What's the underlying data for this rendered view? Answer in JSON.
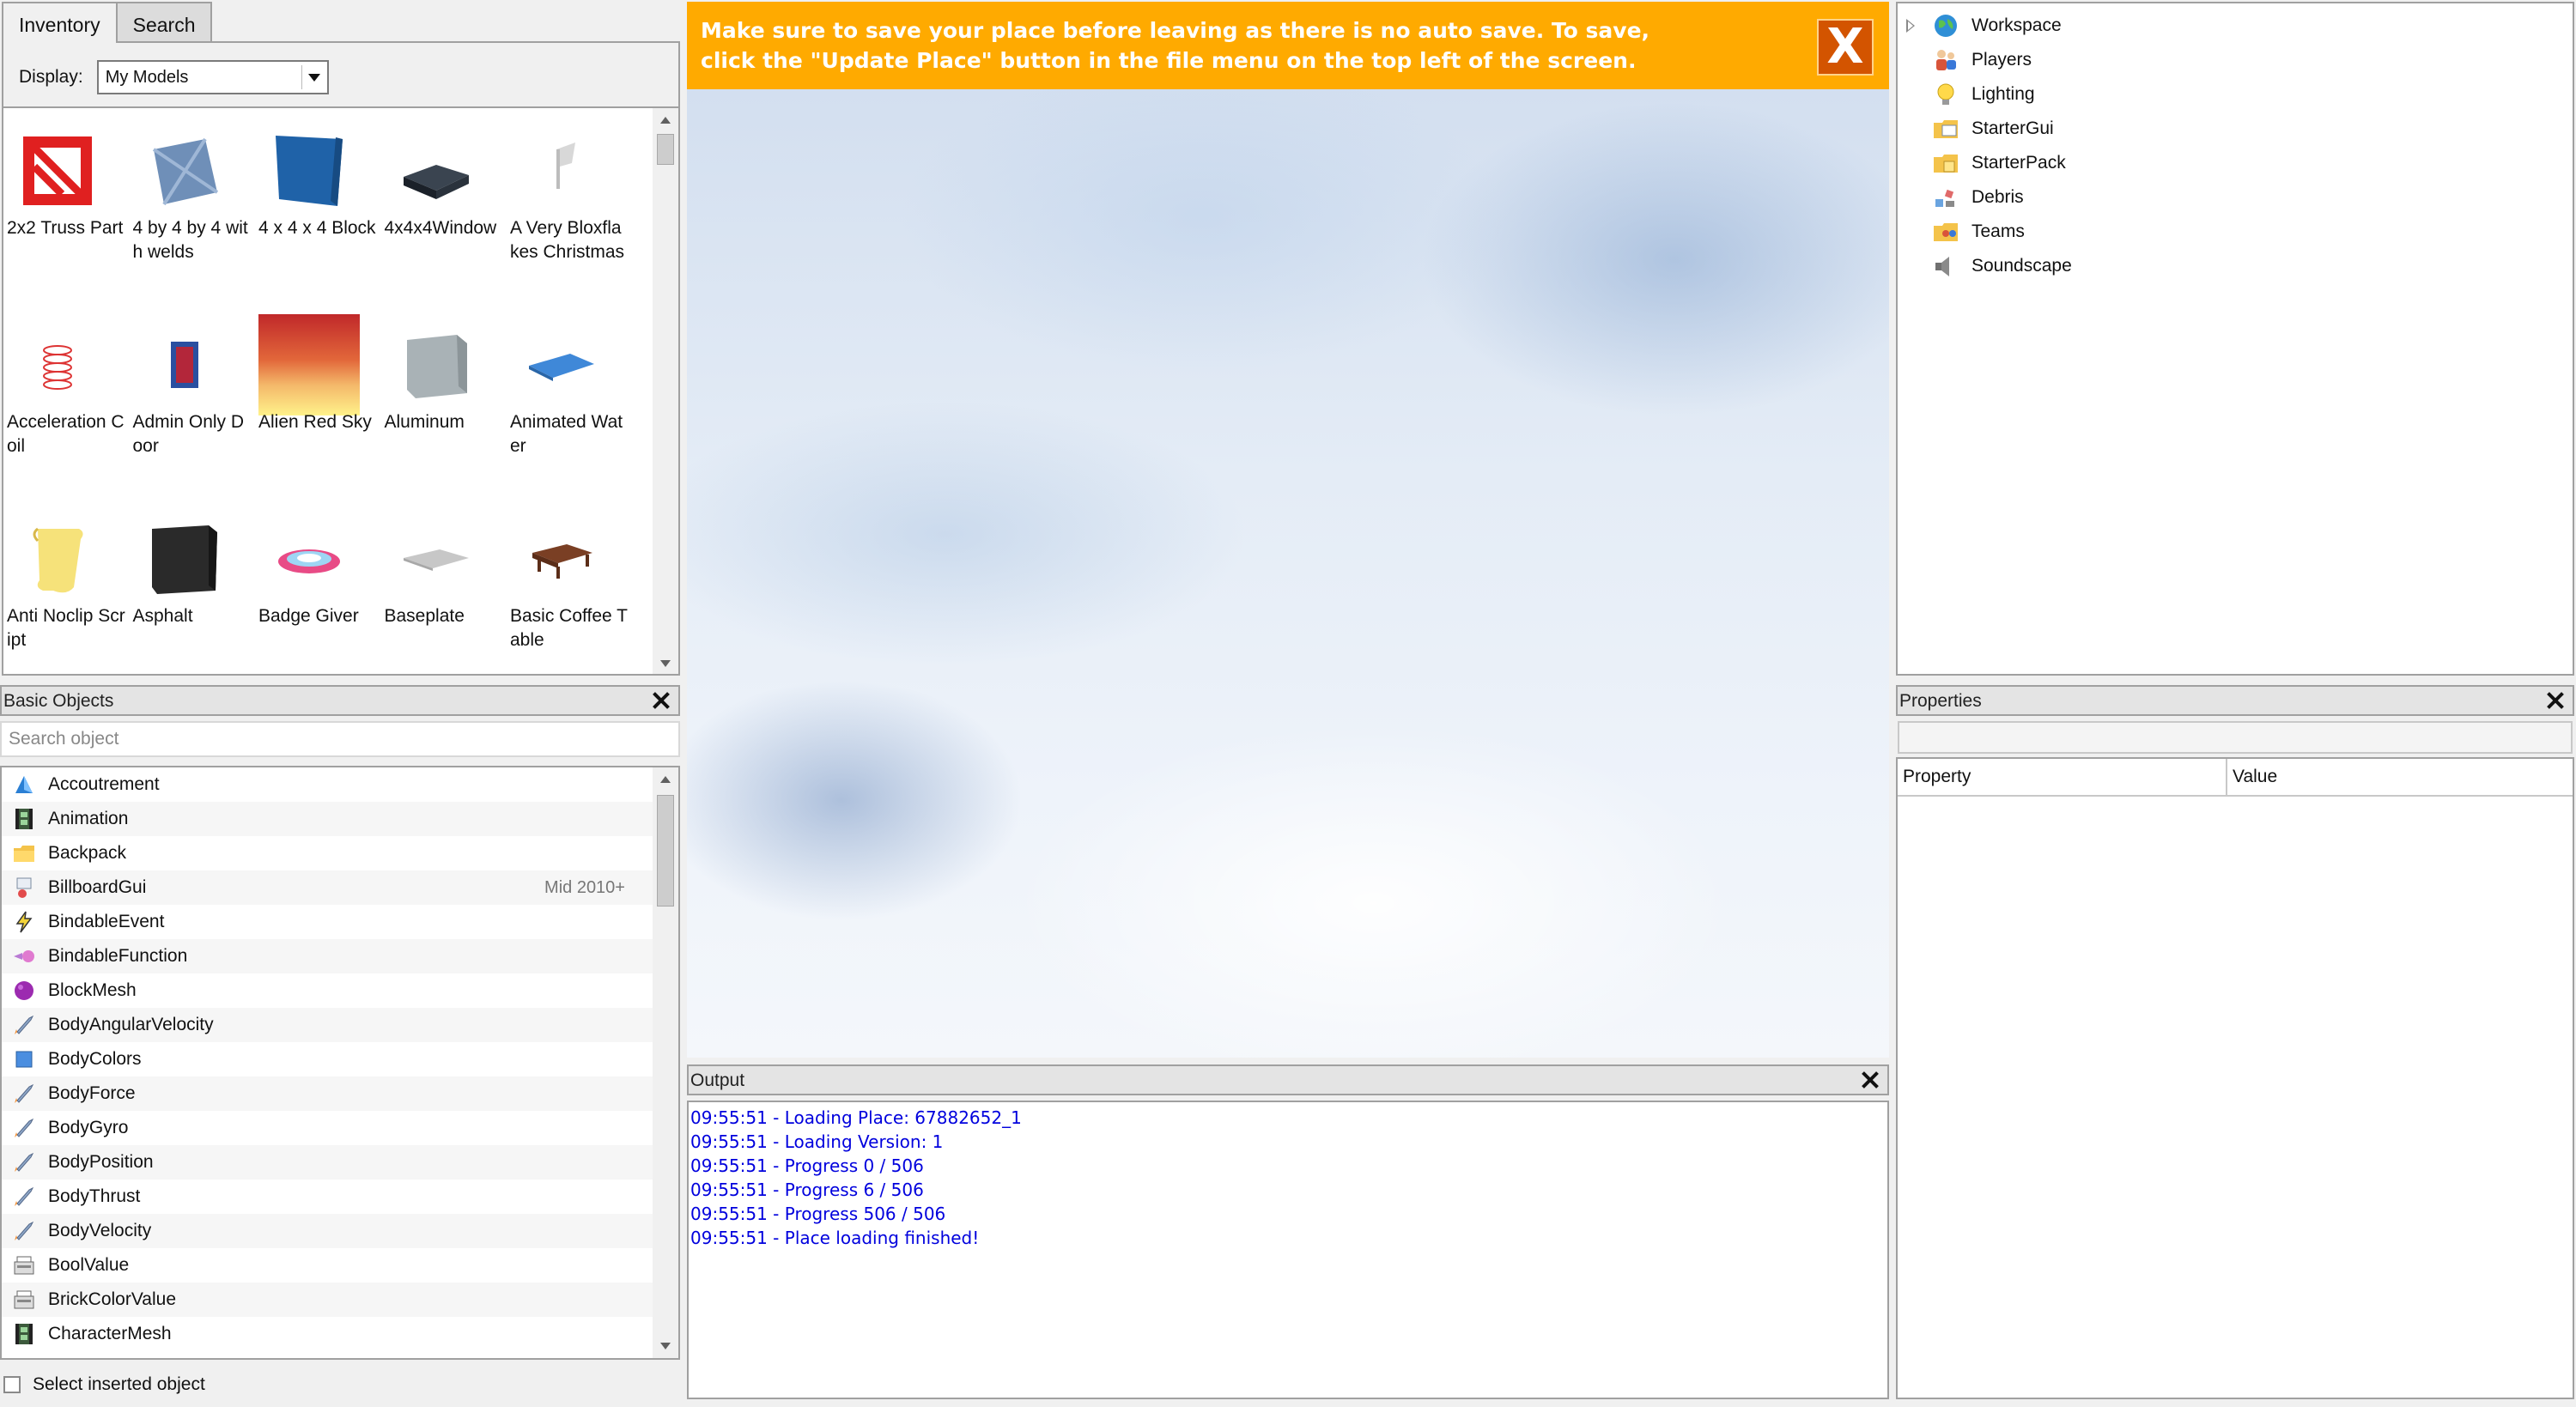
{
  "toolbox": {
    "tabs": [
      "Inventory",
      "Search"
    ],
    "display_label": "Display:",
    "display_value": "My Models",
    "models": [
      {
        "name": "2x2 Truss Part",
        "icon": "red-truss"
      },
      {
        "name": "4 by 4 by 4 with welds",
        "icon": "blue-metal-cube"
      },
      {
        "name": "4 x 4 x 4 Block",
        "icon": "blue-block"
      },
      {
        "name": "4x4x4Window",
        "icon": "dark-window"
      },
      {
        "name": "A Very Bloxflakes Christmas",
        "icon": "white-flag"
      },
      {
        "name": "Acceleration Coil",
        "icon": "red-coil"
      },
      {
        "name": "Admin Only Door",
        "icon": "red-door"
      },
      {
        "name": "Alien Red Sky",
        "icon": "red-sky"
      },
      {
        "name": "Aluminum",
        "icon": "metal-cube"
      },
      {
        "name": "Animated Water",
        "icon": "water-plate"
      },
      {
        "name": "Anti Noclip Script",
        "icon": "scroll"
      },
      {
        "name": "Asphalt",
        "icon": "asphalt-cube"
      },
      {
        "name": "Badge Giver",
        "icon": "badge-pad"
      },
      {
        "name": "Baseplate",
        "icon": "baseplate"
      },
      {
        "name": "Basic Coffee Table",
        "icon": "coffee-table"
      }
    ]
  },
  "basic_objects": {
    "title": "Basic Objects",
    "search_placeholder": "Search object",
    "items": [
      {
        "name": "Accoutrement",
        "icon": "accoutrement-icon",
        "tag": ""
      },
      {
        "name": "Animation",
        "icon": "film-icon",
        "tag": ""
      },
      {
        "name": "Backpack",
        "icon": "folder-icon",
        "tag": ""
      },
      {
        "name": "BillboardGui",
        "icon": "billboard-icon",
        "tag": "Mid 2010+"
      },
      {
        "name": "BindableEvent",
        "icon": "lightning-icon",
        "tag": ""
      },
      {
        "name": "BindableFunction",
        "icon": "function-icon",
        "tag": ""
      },
      {
        "name": "BlockMesh",
        "icon": "purple-sphere-icon",
        "tag": ""
      },
      {
        "name": "BodyAngularVelocity",
        "icon": "rocket-icon",
        "tag": ""
      },
      {
        "name": "BodyColors",
        "icon": "blue-square-icon",
        "tag": ""
      },
      {
        "name": "BodyForce",
        "icon": "rocket-icon",
        "tag": ""
      },
      {
        "name": "BodyGyro",
        "icon": "rocket-icon",
        "tag": ""
      },
      {
        "name": "BodyPosition",
        "icon": "rocket-icon",
        "tag": ""
      },
      {
        "name": "BodyThrust",
        "icon": "rocket-icon",
        "tag": ""
      },
      {
        "name": "BodyVelocity",
        "icon": "rocket-icon",
        "tag": ""
      },
      {
        "name": "BoolValue",
        "icon": "value-icon",
        "tag": ""
      },
      {
        "name": "BrickColorValue",
        "icon": "value-icon",
        "tag": ""
      },
      {
        "name": "CharacterMesh",
        "icon": "film-icon",
        "tag": ""
      }
    ],
    "footer_label": "Select inserted object"
  },
  "banner": {
    "message": "Make sure to save your place before leaving as there is no auto save. To save, click the \"Update Place\" button in the file menu on the top left of the screen.",
    "close_label": "X"
  },
  "output": {
    "title": "Output",
    "lines": [
      "09:55:51 - Loading Place: 67882652_1",
      "09:55:51 - Loading Version: 1",
      "09:55:51 - Progress 0 / 506",
      "09:55:51 - Progress 6 / 506",
      "09:55:51 - Progress 506 / 506",
      "09:55:51 - Place loading finished!"
    ]
  },
  "explorer": {
    "items": [
      {
        "name": "Workspace",
        "icon": "globe-icon"
      },
      {
        "name": "Players",
        "icon": "players-icon"
      },
      {
        "name": "Lighting",
        "icon": "lightbulb-icon"
      },
      {
        "name": "StarterGui",
        "icon": "startergui-icon"
      },
      {
        "name": "StarterPack",
        "icon": "starterpack-icon"
      },
      {
        "name": "Debris",
        "icon": "debris-icon"
      },
      {
        "name": "Teams",
        "icon": "teams-icon"
      },
      {
        "name": "Soundscape",
        "icon": "speaker-icon"
      }
    ]
  },
  "properties": {
    "title": "Properties",
    "col_property": "Property",
    "col_value": "Value"
  },
  "colors": {
    "banner": "#ffaa00",
    "banner_close": "#d35400",
    "output_text": "#0000dd"
  }
}
